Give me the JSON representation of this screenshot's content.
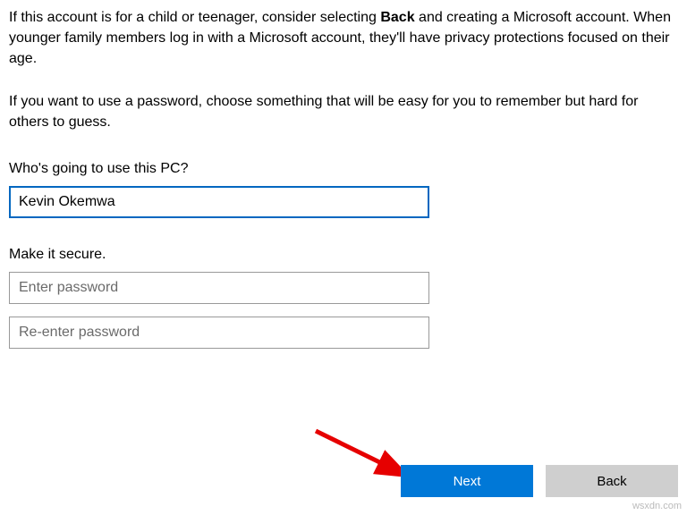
{
  "intro": {
    "para1_prefix": "If this account is for a child or teenager, consider selecting ",
    "para1_bold": "Back",
    "para1_suffix": " and creating a Microsoft account. When younger family members log in with a Microsoft account, they'll have privacy protections focused on their age.",
    "para2": "If you want to use a password, choose something that will be easy for you to remember but hard for others to guess."
  },
  "labels": {
    "who": "Who's going to use this PC?",
    "secure": "Make it secure."
  },
  "fields": {
    "username_value": "Kevin Okemwa",
    "password_placeholder": "Enter password",
    "confirm_placeholder": "Re-enter password"
  },
  "buttons": {
    "next": "Next",
    "back": "Back"
  },
  "watermark": "wsxdn.com"
}
